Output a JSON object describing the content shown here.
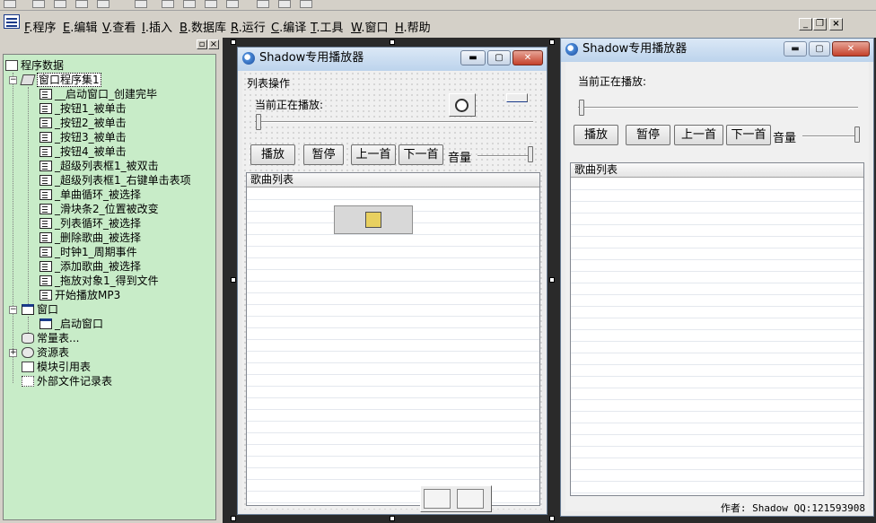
{
  "menubar": {
    "items": [
      {
        "key": "F",
        "label": ".程序"
      },
      {
        "key": "E",
        "label": ".编辑"
      },
      {
        "key": "V",
        "label": ".查看"
      },
      {
        "key": "I",
        "label": ".插入"
      },
      {
        "key": "B",
        "label": ".数据库"
      },
      {
        "key": "R",
        "label": ".运行"
      },
      {
        "key": "C",
        "label": ".编译"
      },
      {
        "key": "T",
        "label": ".工具"
      },
      {
        "key": "W",
        "label": ".窗口"
      },
      {
        "key": "H",
        "label": ".帮助"
      }
    ],
    "mdi_min": "_",
    "mdi_restore": "❐",
    "mdi_close": "×"
  },
  "left_panel": {
    "pin": "▫",
    "close": "×",
    "tree": {
      "root": "程序数据",
      "assembly": "窗口程序集1",
      "subs": [
        "__启动窗口_创建完毕",
        "_按钮1_被单击",
        "_按钮2_被单击",
        "_按钮3_被单击",
        "_按钮4_被单击",
        "_超级列表框1_被双击",
        "_超级列表框1_右键单击表项",
        "_单曲循环_被选择",
        "_滑块条2_位置被改变",
        "_列表循环_被选择",
        "_删除歌曲_被选择",
        "_时钟1_周期事件",
        "_添加歌曲_被选择",
        "_拖放对象1_得到文件",
        "开始播放MP3"
      ],
      "windows_group": "窗口",
      "start_window": "_启动窗口",
      "constants": "常量表...",
      "resources": "资源表",
      "modules": "模块引用表",
      "external": "外部文件记录表",
      "expand_minus": "−",
      "expand_plus": "+"
    }
  },
  "designer": {
    "title": "Shadow专用播放器",
    "menu_caption": "列表操作",
    "now_playing": "当前正在播放:",
    "buttons": {
      "play": "播放",
      "pause": "暂停",
      "prev": "上一首",
      "next": "下一首"
    },
    "volume": "音量",
    "list_header": "歌曲列表"
  },
  "preview": {
    "title": "Shadow专用播放器",
    "now_playing": "当前正在播放:",
    "buttons": {
      "play": "播放",
      "pause": "暂停",
      "prev": "上一首",
      "next": "下一首"
    },
    "volume": "音量",
    "list_header": "歌曲列表",
    "author": "作者: Shadow QQ:121593908"
  },
  "caption_glyphs": {
    "min": "▬",
    "max": "▢",
    "close": "✕"
  }
}
